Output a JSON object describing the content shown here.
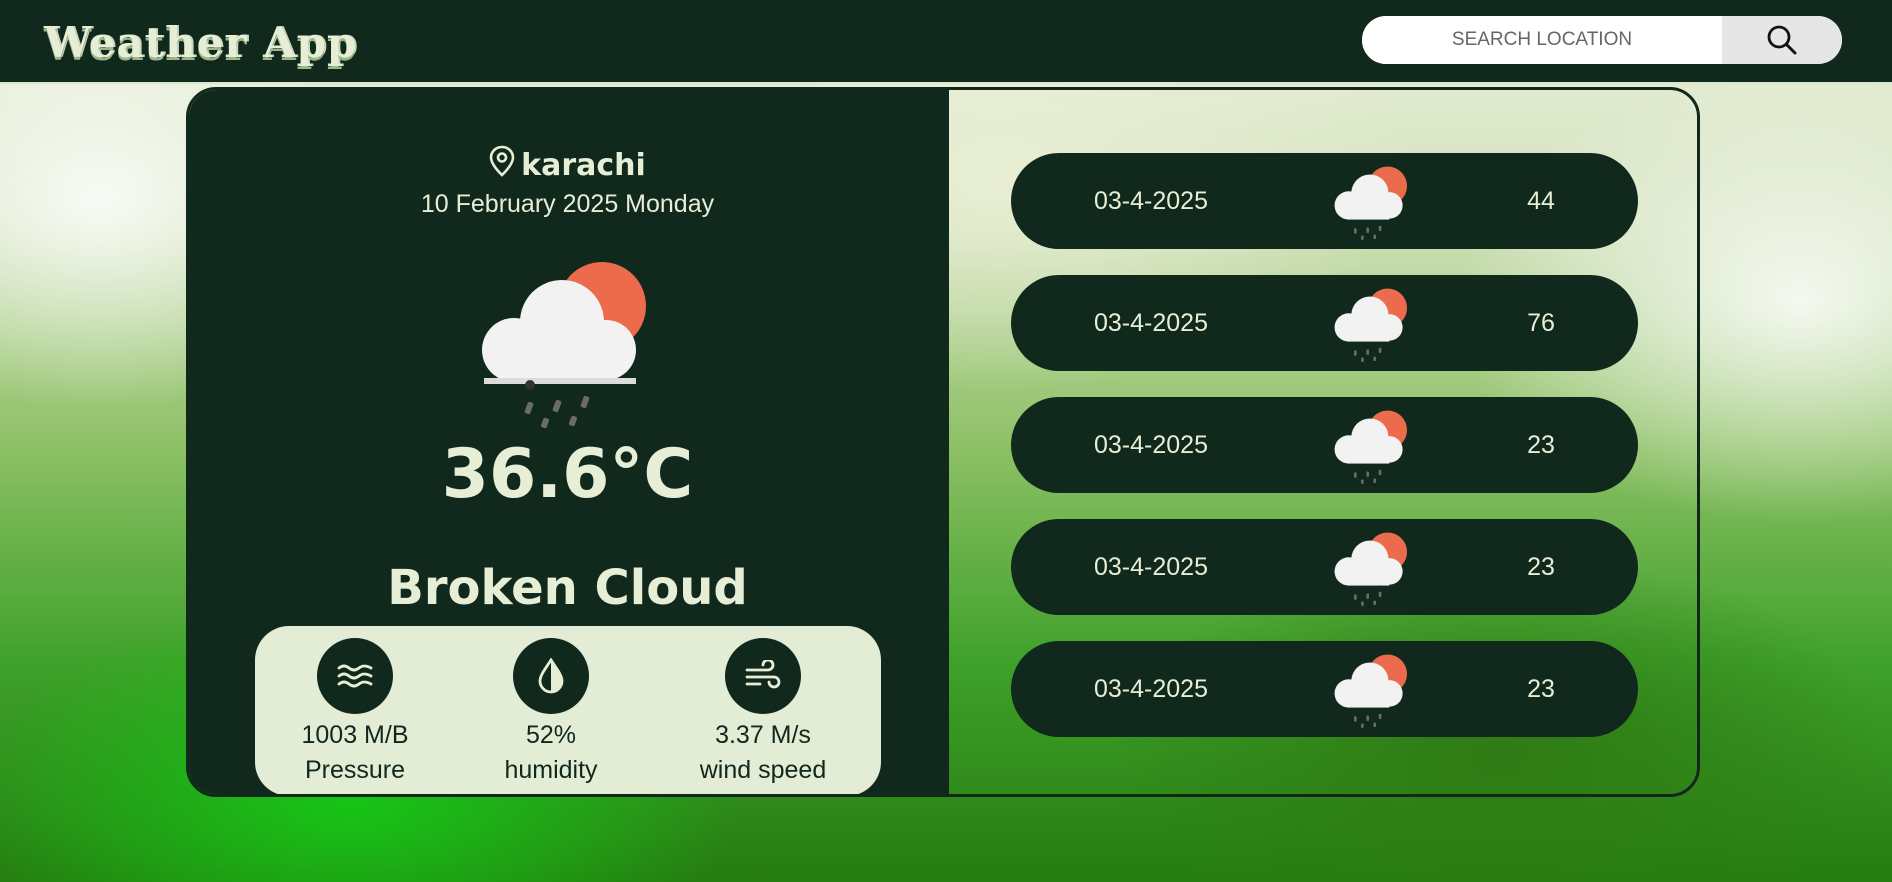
{
  "header": {
    "logo": "Weather App",
    "search_placeholder": "SEARCH LOCATION",
    "search_icon": "search-icon"
  },
  "current": {
    "location_icon": "location-pin-icon",
    "location": "karachi",
    "date": "10 February 2025 Monday",
    "weather_icon": "partly-cloudy-rain-icon",
    "temperature": "36.6°C",
    "condition": "Broken Cloud"
  },
  "stats": [
    {
      "icon": "pressure-waves-icon",
      "value": "1003 M/B",
      "label": "Pressure"
    },
    {
      "icon": "humidity-drop-icon",
      "value": "52%",
      "label": "humidity"
    },
    {
      "icon": "wind-icon",
      "value": "3.37 M/s",
      "label": "wind speed"
    }
  ],
  "forecast": [
    {
      "date": "03-4-2025",
      "icon": "partly-cloudy-rain-icon",
      "value": "44"
    },
    {
      "date": "03-4-2025",
      "icon": "partly-cloudy-rain-icon",
      "value": "76"
    },
    {
      "date": "03-4-2025",
      "icon": "partly-cloudy-rain-icon",
      "value": "23"
    },
    {
      "date": "03-4-2025",
      "icon": "partly-cloudy-rain-icon",
      "value": "23"
    },
    {
      "date": "03-4-2025",
      "icon": "partly-cloudy-rain-icon",
      "value": "23"
    }
  ],
  "colors": {
    "dark": "#11281d",
    "light_text": "#e7eed6",
    "panel": "#e3ecd5",
    "sun": "#ec6b4d"
  }
}
